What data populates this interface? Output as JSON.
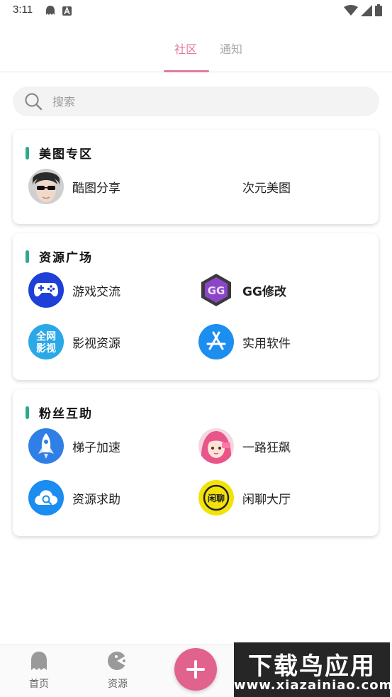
{
  "status_bar": {
    "time": "3:11"
  },
  "tabs": [
    {
      "label": "社区",
      "active": true
    },
    {
      "label": "通知",
      "active": false
    }
  ],
  "search": {
    "placeholder": "搜索"
  },
  "sections": [
    {
      "title": "美图专区",
      "items": [
        {
          "label": "酷图分享",
          "icon": "avatar-photo-icon"
        },
        {
          "label": "次元美图",
          "icon": ""
        }
      ]
    },
    {
      "title": "资源广场",
      "items": [
        {
          "label": "游戏交流",
          "icon": "gamepad-icon"
        },
        {
          "label": "GG修改",
          "icon": "gg-logo-icon"
        },
        {
          "label": "影视资源",
          "icon": "video-badge-icon"
        },
        {
          "label": "实用软件",
          "icon": "app-store-icon"
        }
      ]
    },
    {
      "title": "粉丝互助",
      "items": [
        {
          "label": "梯子加速",
          "icon": "rocket-icon"
        },
        {
          "label": "一路狂飙",
          "icon": "anime-avatar-icon"
        },
        {
          "label": "资源求助",
          "icon": "cloud-search-icon"
        },
        {
          "label": "闲聊大厅",
          "icon": "chat-badge-icon"
        }
      ]
    }
  ],
  "icon_text": {
    "gg": "GG",
    "video_badge_top": "全网",
    "video_badge_bottom": "影视",
    "chat_badge": "闲聊"
  },
  "bottom_nav": {
    "home_label": "首页",
    "resources_label": "资源"
  },
  "watermark": {
    "title": "下载鸟应用",
    "url": "www.xiazainiao.com"
  },
  "colors": {
    "accent": "#e07aa0",
    "section_bar": "#2fa88f",
    "fab": "#e0628d"
  }
}
